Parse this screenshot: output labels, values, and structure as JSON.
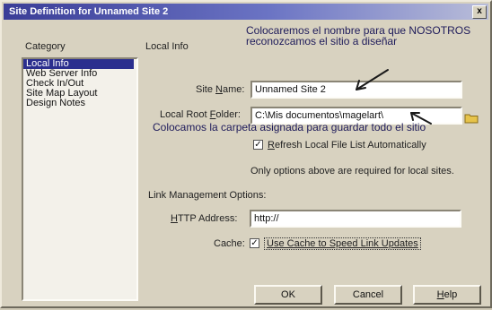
{
  "window": {
    "title": "Site Definition for Unnamed Site 2",
    "close_glyph": "x"
  },
  "annotations": {
    "top_line1": "Colocaremos el nombre para que NOSOTROS",
    "top_line2": "reconozcamos el sitio a diseñar",
    "middle": "Colocamos la carpeta asignada para guardar todo el sitio"
  },
  "headers": {
    "category": "Category",
    "section": "Local Info"
  },
  "categories": [
    {
      "label": "Local Info",
      "selected": true
    },
    {
      "label": "Web Server Info",
      "selected": false
    },
    {
      "label": "Check In/Out",
      "selected": false
    },
    {
      "label": "Site Map Layout",
      "selected": false
    },
    {
      "label": "Design Notes",
      "selected": false
    }
  ],
  "site_name": {
    "label_prefix": "Site ",
    "label_accel": "N",
    "label_suffix": "ame:",
    "value": "Unnamed Site 2"
  },
  "local_root": {
    "label_prefix": "Local Root ",
    "label_accel": "F",
    "label_suffix": "older:",
    "value": "C:\\Mis documentos\\magelart\\"
  },
  "refresh": {
    "checked": true,
    "check_glyph": "✓",
    "label_accel": "R",
    "label_rest": "efresh Local File List Automatically"
  },
  "info_text": "Only options above are required for local sites.",
  "link_mgmt": {
    "heading": "Link Management Options:"
  },
  "http": {
    "label_accel": "H",
    "label_rest": "TTP Address:",
    "value": "http://"
  },
  "cache": {
    "label": "Cache:",
    "checked": true,
    "check_glyph": "✓",
    "option_accel": "U",
    "option_rest": "se Cache to Speed Link Updates"
  },
  "buttons": {
    "ok": "OK",
    "cancel": "Cancel",
    "help_accel": "H",
    "help_rest": "elp"
  },
  "colors": {
    "titlebar": "#3a3d97",
    "annotation": "#1d1a5a",
    "selection": "#2b2f8e"
  }
}
